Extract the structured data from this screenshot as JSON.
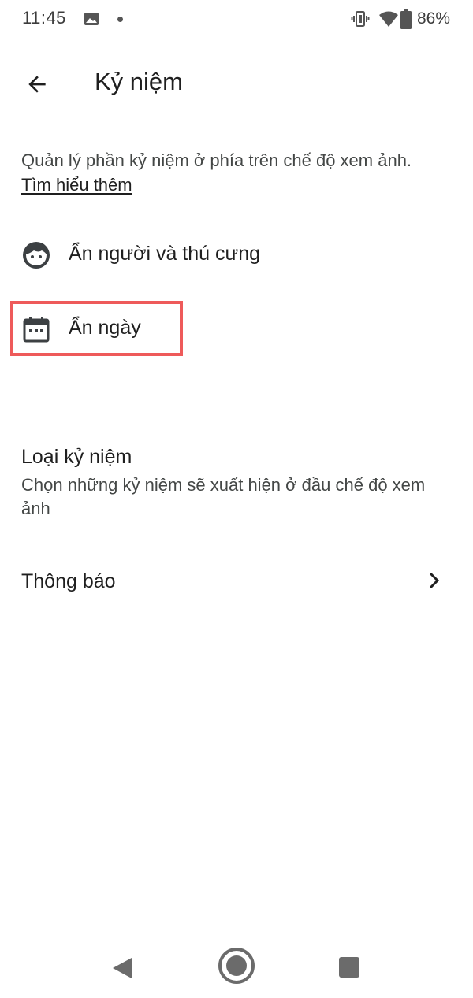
{
  "status_bar": {
    "time": "11:45",
    "battery": "86%",
    "icons": [
      "gallery-icon",
      "notification-dot-icon",
      "vibrate-icon",
      "wifi-icon",
      "battery-icon"
    ]
  },
  "app_bar": {
    "title": "Kỷ niệm",
    "back_icon": "arrow-back-icon"
  },
  "description": {
    "text": "Quản lý phần kỷ niệm ở phía trên chế độ xem ảnh.",
    "learn_more": "Tìm hiểu thêm"
  },
  "rows": [
    {
      "label": "Ẩn người và thú cưng",
      "icon": "face-icon"
    },
    {
      "label": "Ẩn ngày",
      "icon": "calendar-icon"
    }
  ],
  "sections": {
    "memory_types": {
      "title": "Loại kỷ niệm",
      "subtitle": "Chọn những kỷ niệm sẽ xuất hiện ở đầu chế độ xem ảnh"
    },
    "notifications": {
      "title": "Thông báo",
      "icon": "chevron-right-icon"
    }
  },
  "colors": {
    "highlight": "#ee5a5a",
    "text_primary": "#1f1f1f",
    "text_secondary": "#444746"
  },
  "nav_bar": {
    "icons": [
      "nav-back-icon",
      "nav-home-icon",
      "nav-recents-icon"
    ]
  }
}
